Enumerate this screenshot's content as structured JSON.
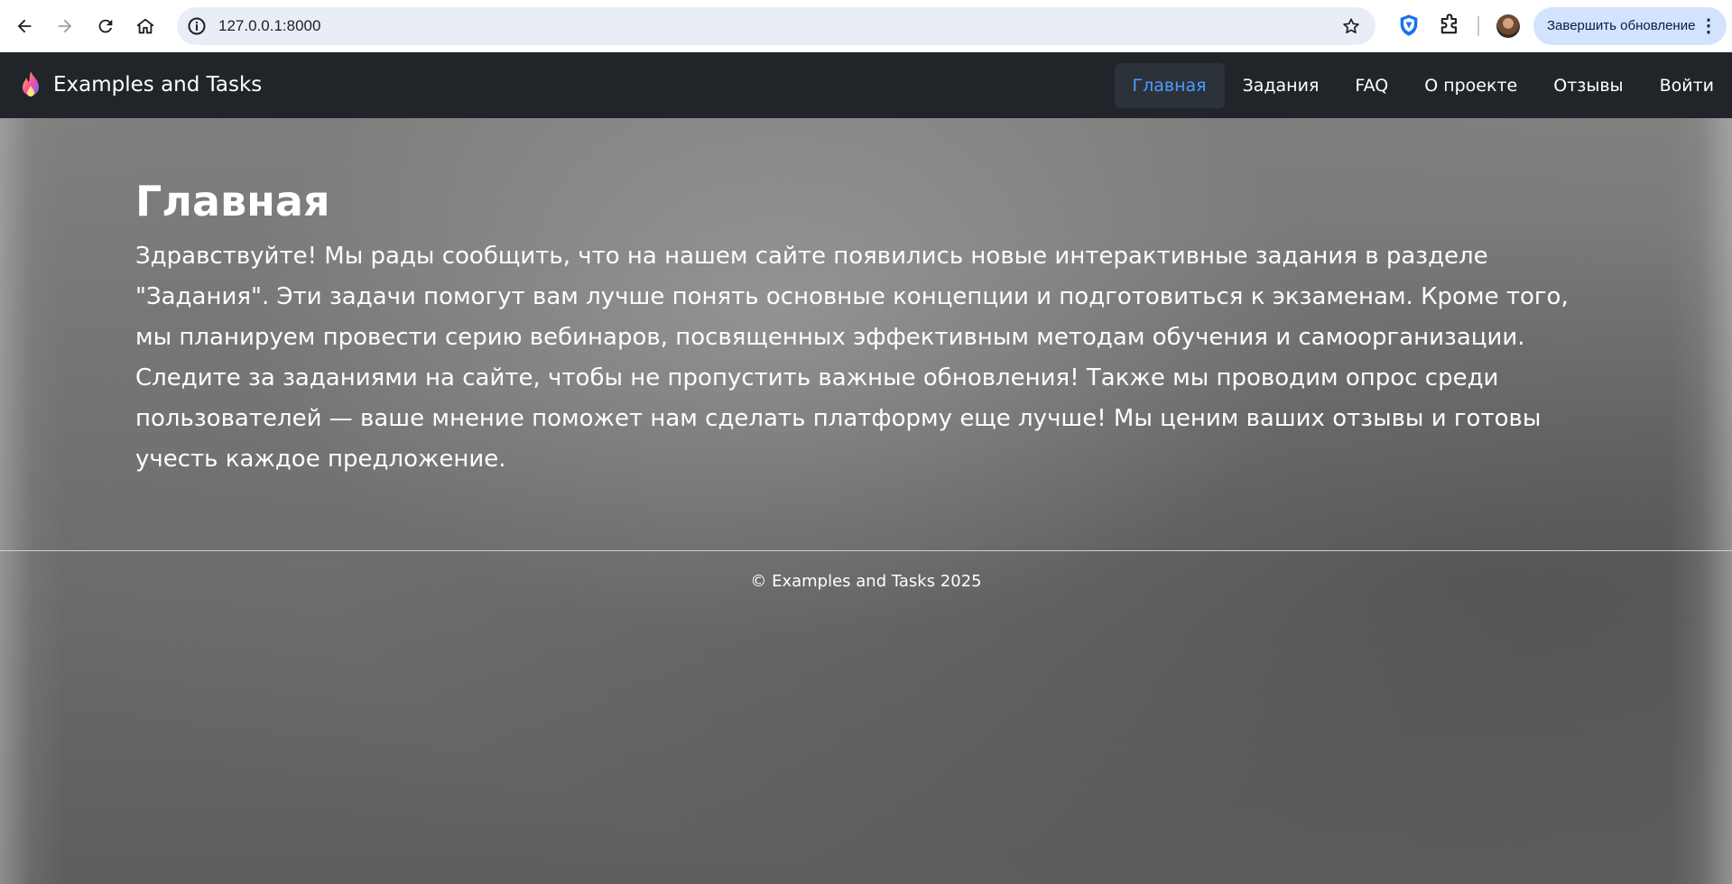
{
  "browser": {
    "url": "127.0.0.1:8000",
    "update_button_label": "Завершить обновление",
    "menu_glyph": "⋮"
  },
  "site": {
    "brand": "Examples and Tasks",
    "nav": {
      "items": [
        {
          "label": "Главная",
          "active": true
        },
        {
          "label": "Задания",
          "active": false
        },
        {
          "label": "FAQ",
          "active": false
        },
        {
          "label": "О проекте",
          "active": false
        },
        {
          "label": "Отзывы",
          "active": false
        },
        {
          "label": "Войти",
          "active": false
        }
      ]
    }
  },
  "main": {
    "title": "Главная",
    "text": "Здравствуйте! Мы рады сообщить, что на нашем сайте появились новые интерактивные задания в разделе \"Задания\". Эти задачи помогут вам лучше понять основные концепции и подготовиться к экзаменам. Кроме того, мы планируем провести серию вебинаров, посвященных эффективным методам обучения и самоорганизации. Следите за заданиями на сайте, чтобы не пропустить важные обновления! Также мы проводим опрос среди пользователей — ваше мнение поможет нам сделать платформу еще лучше! Мы ценим ваших отзывы и готовы учесть каждое предложение."
  },
  "footer": {
    "text": "© Examples and Tasks 2025"
  },
  "colors": {
    "navbar_bg": "#212529",
    "active_link": "#4c9dff",
    "update_button_bg": "#d3e3fd"
  }
}
